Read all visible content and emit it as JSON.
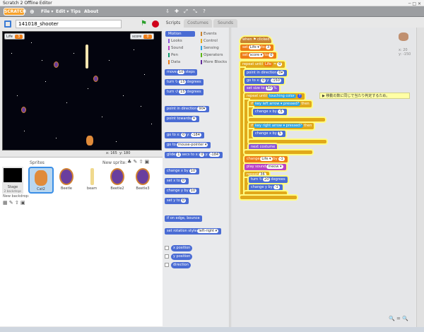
{
  "window": {
    "title": "Scratch 2 Offline Editor",
    "controls": "─  □  ✕"
  },
  "menubar": {
    "logo": "SCRATCH",
    "globe_icon": "globe-icon",
    "items": [
      "File ▾",
      "Edit ▾",
      "Tips",
      "About"
    ],
    "tools": [
      "⇩",
      "✚",
      "⤢",
      "⤡",
      "?"
    ]
  },
  "project": {
    "name": "141018_shooter"
  },
  "stage": {
    "monitors": [
      {
        "label": "Life",
        "value": "3"
      },
      {
        "label": "score",
        "value": "0"
      }
    ],
    "coords": {
      "x_label": "x:",
      "x_value": "165",
      "y_label": "y:",
      "y_value": "180"
    }
  },
  "sprites": {
    "title": "Sprites",
    "new_sprite_label": "New sprite:",
    "stage_label": "Stage",
    "stage_sub": "2 backdrops",
    "new_backdrop_label": "New backdrop:",
    "items": [
      {
        "name": "Cat2",
        "selected": true
      },
      {
        "name": "Beetle"
      },
      {
        "name": "beam"
      },
      {
        "name": "Beetle2"
      },
      {
        "name": "Beetle3"
      }
    ]
  },
  "tabs": [
    "Scripts",
    "Costumes",
    "Sounds"
  ],
  "categories": [
    {
      "name": "Motion",
      "color": "#4a6cd4",
      "selected": true
    },
    {
      "name": "Looks",
      "color": "#8a55d7"
    },
    {
      "name": "Sound",
      "color": "#bb42c3"
    },
    {
      "name": "Pen",
      "color": "#0e9a6c"
    },
    {
      "name": "Data",
      "color": "#ee7d16"
    },
    {
      "name": "Events",
      "color": "#c88330"
    },
    {
      "name": "Control",
      "color": "#e1a91a"
    },
    {
      "name": "Sensing",
      "color": "#2ca5e2"
    },
    {
      "name": "Operators",
      "color": "#5cb712"
    },
    {
      "name": "More Blocks",
      "color": "#632d99"
    }
  ],
  "palette": {
    "move": {
      "a": "move",
      "v": "10",
      "b": "steps"
    },
    "turn_cw": {
      "a": "turn ↻",
      "v": "15",
      "b": "degrees"
    },
    "turn_ccw": {
      "a": "turn ↺",
      "v": "15",
      "b": "degrees"
    },
    "point_dir": {
      "a": "point in direction",
      "v": "90▾"
    },
    "point_towards": {
      "a": "point towards",
      "v": "▾"
    },
    "goto_xy": {
      "a": "go to x:",
      "v1": "0",
      "b": "y:",
      "v2": "-184"
    },
    "goto": {
      "a": "go to",
      "v": "mouse-pointer ▾"
    },
    "glide": {
      "a": "glide",
      "v1": "1",
      "b": "secs to x:",
      "v2": "0",
      "c": "y:",
      "v3": "-184"
    },
    "change_x": {
      "a": "change x by",
      "v": "10"
    },
    "set_x": {
      "a": "set x to",
      "v": "0"
    },
    "change_y": {
      "a": "change y by",
      "v": "10"
    },
    "set_y": {
      "a": "set y to",
      "v": "0"
    },
    "bounce": {
      "a": "if on edge, bounce"
    },
    "rotation": {
      "a": "set rotation style",
      "v": "left-right ▾"
    },
    "reporters": [
      "x position",
      "y position",
      "direction"
    ]
  },
  "script": {
    "hat": "when ⚑ clicked",
    "set_life": {
      "a": "set",
      "v1": "Life ▾",
      "b": "to",
      "v2": "3"
    },
    "set_score": {
      "a": "set",
      "v1": "score ▾",
      "b": "to",
      "v2": "0"
    },
    "repeat_until": {
      "a": "repeat until",
      "v1": "Life",
      "b": "=",
      "v2": "0"
    },
    "point_dir": {
      "a": "point in direction",
      "v": "0▾"
    },
    "goto_xy": {
      "a": "go to x:",
      "v1": "0",
      "b": "y:",
      "v2": "-150"
    },
    "set_size": {
      "a": "set size to",
      "v": "50",
      "b": "%"
    },
    "repeat_touch": {
      "a": "repeat until",
      "b": "touching color",
      "v": "?"
    },
    "comment": "▶ 移動の数に同じで当たり判定するため。",
    "if1": {
      "a": "if",
      "b": "key",
      "v": "left arrow ▾",
      "c": "pressed?",
      "d": "then"
    },
    "change_x1": {
      "a": "change x by",
      "v": "-5"
    },
    "if2": {
      "a": "if",
      "b": "key",
      "v": "right arrow ▾",
      "c": "pressed?",
      "d": "then"
    },
    "change_x2": {
      "a": "change x by",
      "v": "5"
    },
    "next_costume": {
      "a": "next costume"
    },
    "change_life": {
      "a": "change",
      "v1": "Life ▾",
      "b": "by",
      "v2": "-1"
    },
    "play_sound": {
      "a": "play sound",
      "v": "meow ▾"
    },
    "repeat36": {
      "a": "repeat",
      "v": "36"
    },
    "turn": {
      "a": "turn ↻",
      "v": "20",
      "b": "degrees"
    },
    "change_y": {
      "a": "change y by",
      "v": "-1"
    }
  },
  "sprite_info": {
    "x": "x: 20",
    "y": "y: -150"
  },
  "zoom": "🔍 = 🔍"
}
